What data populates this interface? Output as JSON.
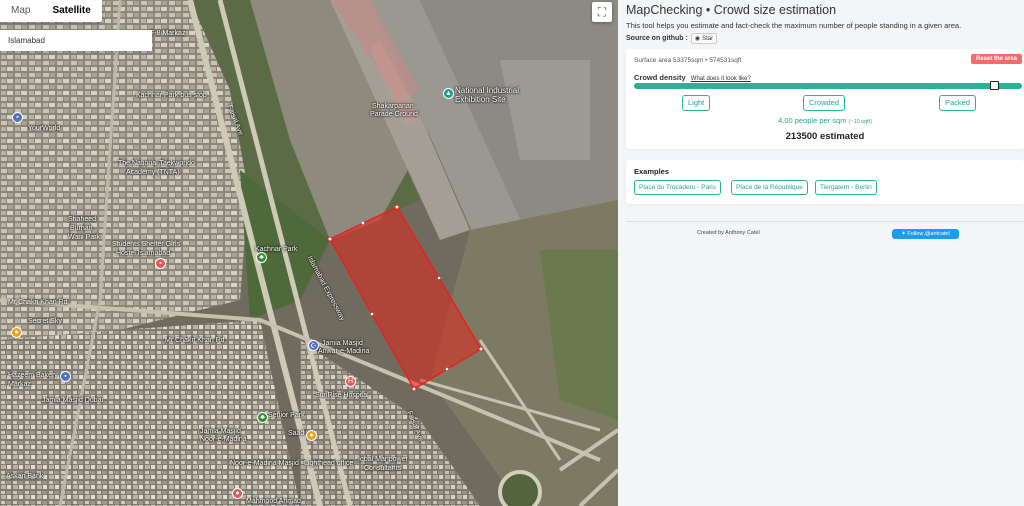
{
  "map": {
    "type_controls": {
      "map_label": "Map",
      "satellite_label": "Satellite"
    },
    "search": {
      "value": "Islamabad"
    },
    "labels": {
      "f8_markaz": "F-8 Markaz",
      "kachnar_bus_stop": "Kachnar Park bus stop",
      "your_world": "YourWorld",
      "taekwondo": "The National Taekwondo",
      "taekwondo2": "Academy (TNTA)",
      "shaheed_park": "Shaheed",
      "shaheed_park2": "Burhan",
      "shaheed_park3": "Wani Park",
      "students_hostel": "Students Shelter Girls",
      "students_hostel2": "Hostel Islamabad",
      "kachnar_park": "Kachnar Park",
      "faizabad_exp": "Islamabad Expressway",
      "faisal_ave": "Faisal Ave",
      "faisal_ave2": "Faisal Ave",
      "industrial_exhibition": "National Industrial",
      "industrial_exhibition2": "Exhibition Site",
      "shakarparian": "Shakarparian",
      "shakarparian2": "Parade Ground",
      "chaklala_rd": "Mr Chakri Khan Rd",
      "chaklala_rd2": "Mr Chakri Khan Rd",
      "secret_sky": "Secret Sky",
      "jamia_masjid": "Jamia Masjid",
      "jamia_masjid2": "Anwar-e-Madina",
      "sunrise": "SunRise Hospital",
      "secure_park": "Senior Park",
      "jamia_noor": "Jamia Masjid",
      "jamia_noor2": "Noor-e-Madina",
      "saad": "Saad",
      "noor_madina": "Noor-e-Madina Masjid",
      "lighthead": "Lighthead office",
      "manpower": "Iqbal Manpower",
      "manpower2": "Consultants",
      "askari_bank": "Askari Bank",
      "jamia_dubai": "Jamia Masjid Dubai",
      "hazeem_bakery": "Hazeem Bakery",
      "markaz": "Markaz",
      "mahmood": "Mahmood Ahmad"
    }
  },
  "panel": {
    "title": "MapChecking • Crowd size estimation",
    "description": "This tool helps you estimate and fact-check the maximum number of people standing in a given area.",
    "source_label": "Source on github :",
    "star_label": "Star",
    "surface_area": "Surface area 53375sqm • 574531sqft",
    "reset_label": "Reset the area",
    "density_label": "Crowd density",
    "density_link": "What does it look like?",
    "density_level": 0.94,
    "buttons": {
      "light": "Light",
      "crowded": "Crowded",
      "packed": "Packed"
    },
    "people_per_sqm": "4.00 people per sqm",
    "people_per_sqft": "(~10 sqft)",
    "estimate": "213500 estimated",
    "examples_title": "Examples",
    "examples": [
      "Place du Trocadero - Paris",
      "Place de la République",
      "Tiergatern - Berlin"
    ],
    "credit": "Created by Anthony Catel",
    "twitter_label": "Follow @antcatel"
  },
  "colors": {
    "accent": "#26b39a",
    "reset": "#f56a6a",
    "twitter": "#1d9bf0",
    "selection": "#e3241c"
  }
}
